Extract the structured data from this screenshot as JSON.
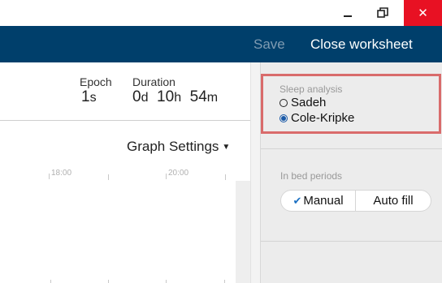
{
  "window": {
    "minimize_icon": "minimize-icon",
    "maximize_icon": "restore-icon",
    "close_glyph": "✕"
  },
  "header": {
    "save_label": "Save",
    "close_label": "Close worksheet"
  },
  "stats": {
    "epoch_label": "Epoch",
    "epoch_value": "1",
    "epoch_unit": "s",
    "duration_label": "Duration",
    "duration_days": "0",
    "duration_days_unit": "d",
    "duration_hours": "10",
    "duration_hours_unit": "h",
    "duration_minutes": "54",
    "duration_minutes_unit": "m"
  },
  "graph": {
    "settings_label": "Graph Settings",
    "ticks": [
      "18:00",
      "20:00"
    ]
  },
  "sleep_analysis": {
    "title": "Sleep analysis",
    "options": [
      {
        "label": "Sadeh",
        "selected": false
      },
      {
        "label": "Cole-Kripke",
        "selected": true
      }
    ]
  },
  "in_bed": {
    "title": "In bed periods",
    "options": [
      {
        "label": "Manual",
        "selected": true
      },
      {
        "label": "Auto fill",
        "selected": false
      }
    ]
  },
  "colors": {
    "header_bg": "#003f6b",
    "close_button": "#e81123",
    "highlight_border": "#d96b6b",
    "selected_accent": "#1a5aa8"
  }
}
